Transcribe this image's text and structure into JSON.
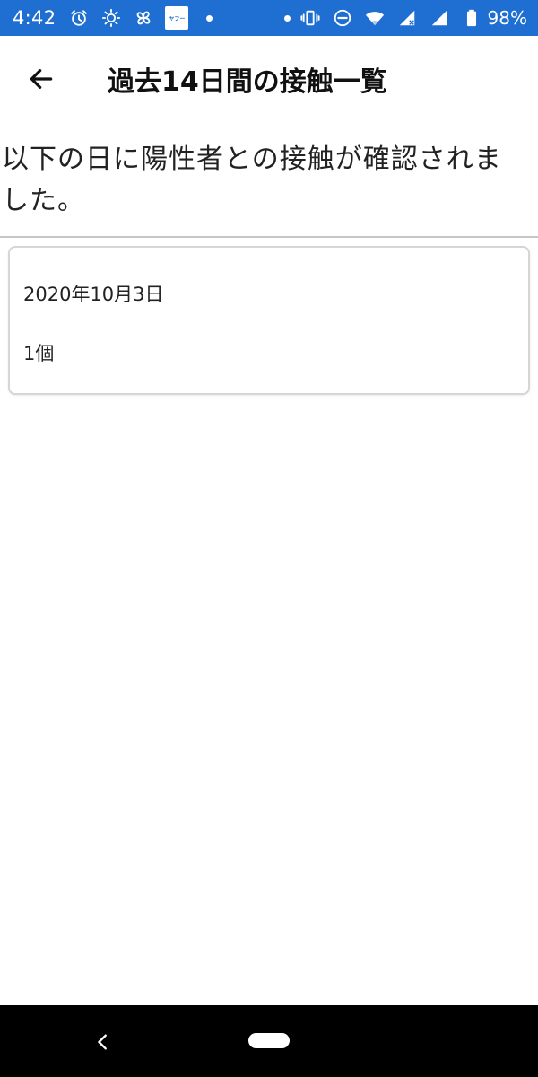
{
  "status_bar": {
    "time": "4:42",
    "yahoo_badge_text": "ヤフー",
    "battery": "98%",
    "icons": [
      "alarm-icon",
      "brightness-icon",
      "pinwheel-icon",
      "yahoo-app-icon",
      "dot-icon",
      "dot-icon",
      "vibrate-icon",
      "do-not-disturb-icon",
      "wifi-icon",
      "signal-icon",
      "signal-icon",
      "battery-icon"
    ]
  },
  "app_bar": {
    "title": "過去14日間の接触一覧",
    "back_icon": "arrow-left-icon"
  },
  "main": {
    "description": "以下の日に陽性者との接触が確認されました。",
    "contacts": [
      {
        "date": "2020年10月3日",
        "count": "1個"
      }
    ]
  },
  "nav_bar": {
    "back_icon": "chevron-left-icon",
    "home_icon": "home-pill-icon"
  },
  "colors": {
    "status_bar_bg": "#1e6fd1",
    "nav_bar_bg": "#000000",
    "card_border": "#d6d6d6"
  }
}
